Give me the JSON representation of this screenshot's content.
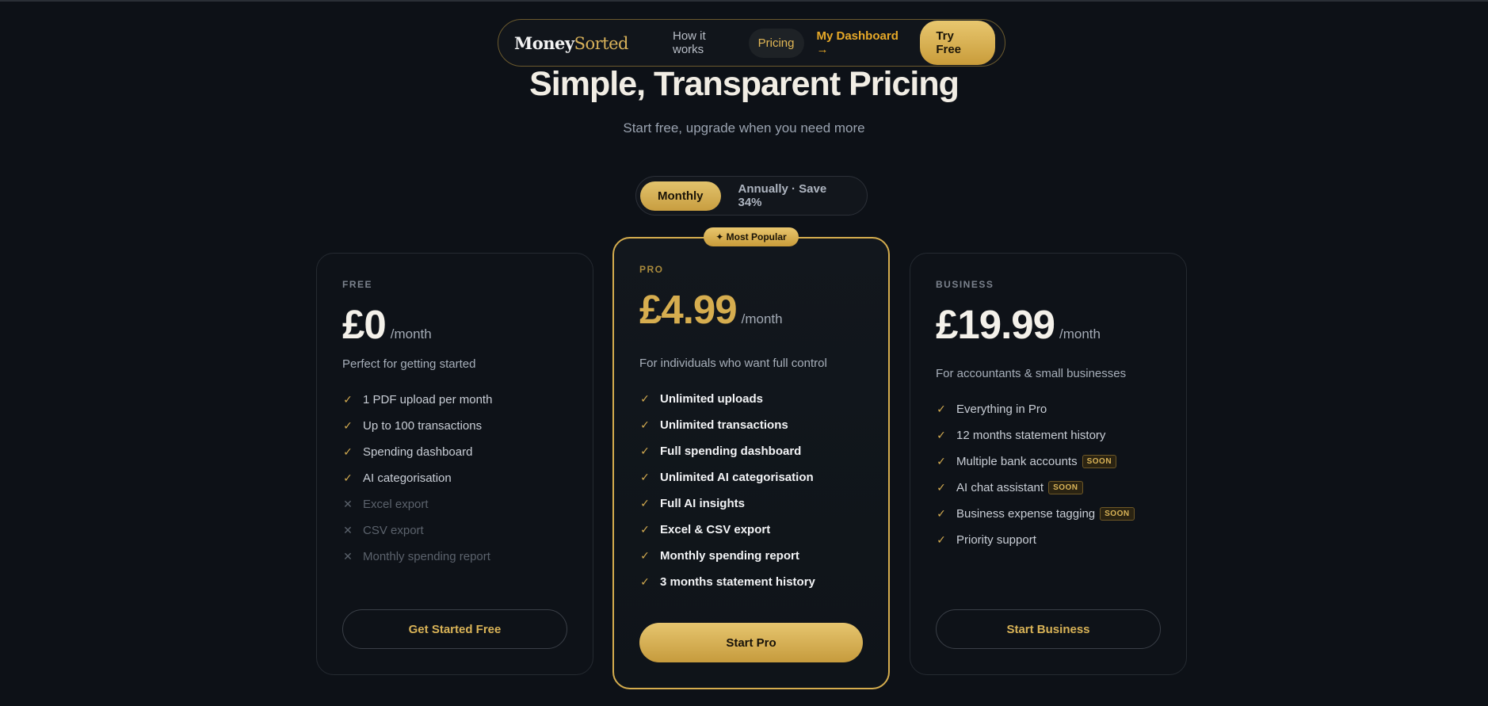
{
  "nav": {
    "logo_bold": "Money",
    "logo_light": "Sorted",
    "links": [
      "How it works",
      "Pricing"
    ],
    "dashboard": "My Dashboard →",
    "try_free": "Try Free"
  },
  "hero": {
    "title": "Simple, Transparent Pricing",
    "subtitle": "Start free, upgrade when you need more"
  },
  "billing_toggle": {
    "monthly": "Monthly",
    "annually": "Annually · Save 34%",
    "selected": "Monthly"
  },
  "colors": {
    "accent": "#d6ad4f",
    "background": "#0d1117"
  },
  "plans": {
    "free": {
      "tier": "FREE",
      "price": "£0",
      "period": "/month",
      "description": "Perfect for getting started",
      "features": [
        {
          "text": "1 PDF upload per month",
          "included": true
        },
        {
          "text": "Up to 100 transactions",
          "included": true
        },
        {
          "text": "Spending dashboard",
          "included": true
        },
        {
          "text": "AI categorisation",
          "included": true
        },
        {
          "text": "Excel export",
          "included": false
        },
        {
          "text": "CSV export",
          "included": false
        },
        {
          "text": "Monthly spending report",
          "included": false
        }
      ],
      "cta": "Get Started Free"
    },
    "pro": {
      "badge": "✦ Most Popular",
      "tier": "PRO",
      "price": "£4.99",
      "period": "/month",
      "description": "For individuals who want full control",
      "features": [
        {
          "text": "Unlimited uploads",
          "included": true
        },
        {
          "text": "Unlimited transactions",
          "included": true
        },
        {
          "text": "Full spending dashboard",
          "included": true
        },
        {
          "text": "Unlimited AI categorisation",
          "included": true
        },
        {
          "text": "Full AI insights",
          "included": true
        },
        {
          "text": "Excel & CSV export",
          "included": true
        },
        {
          "text": "Monthly spending report",
          "included": true
        },
        {
          "text": "3 months statement history",
          "included": true
        }
      ],
      "cta": "Start Pro"
    },
    "business": {
      "tier": "BUSINESS",
      "price": "£19.99",
      "period": "/month",
      "description": "For accountants & small businesses",
      "features": [
        {
          "text": "Everything in Pro",
          "included": true
        },
        {
          "text": "12 months statement history",
          "included": true
        },
        {
          "text": "Multiple bank accounts",
          "included": true,
          "soon": "SOON"
        },
        {
          "text": "AI chat assistant",
          "included": true,
          "soon": "SOON"
        },
        {
          "text": "Business expense tagging",
          "included": true,
          "soon": "SOON"
        },
        {
          "text": "Priority support",
          "included": true
        }
      ],
      "cta": "Start Business"
    }
  }
}
